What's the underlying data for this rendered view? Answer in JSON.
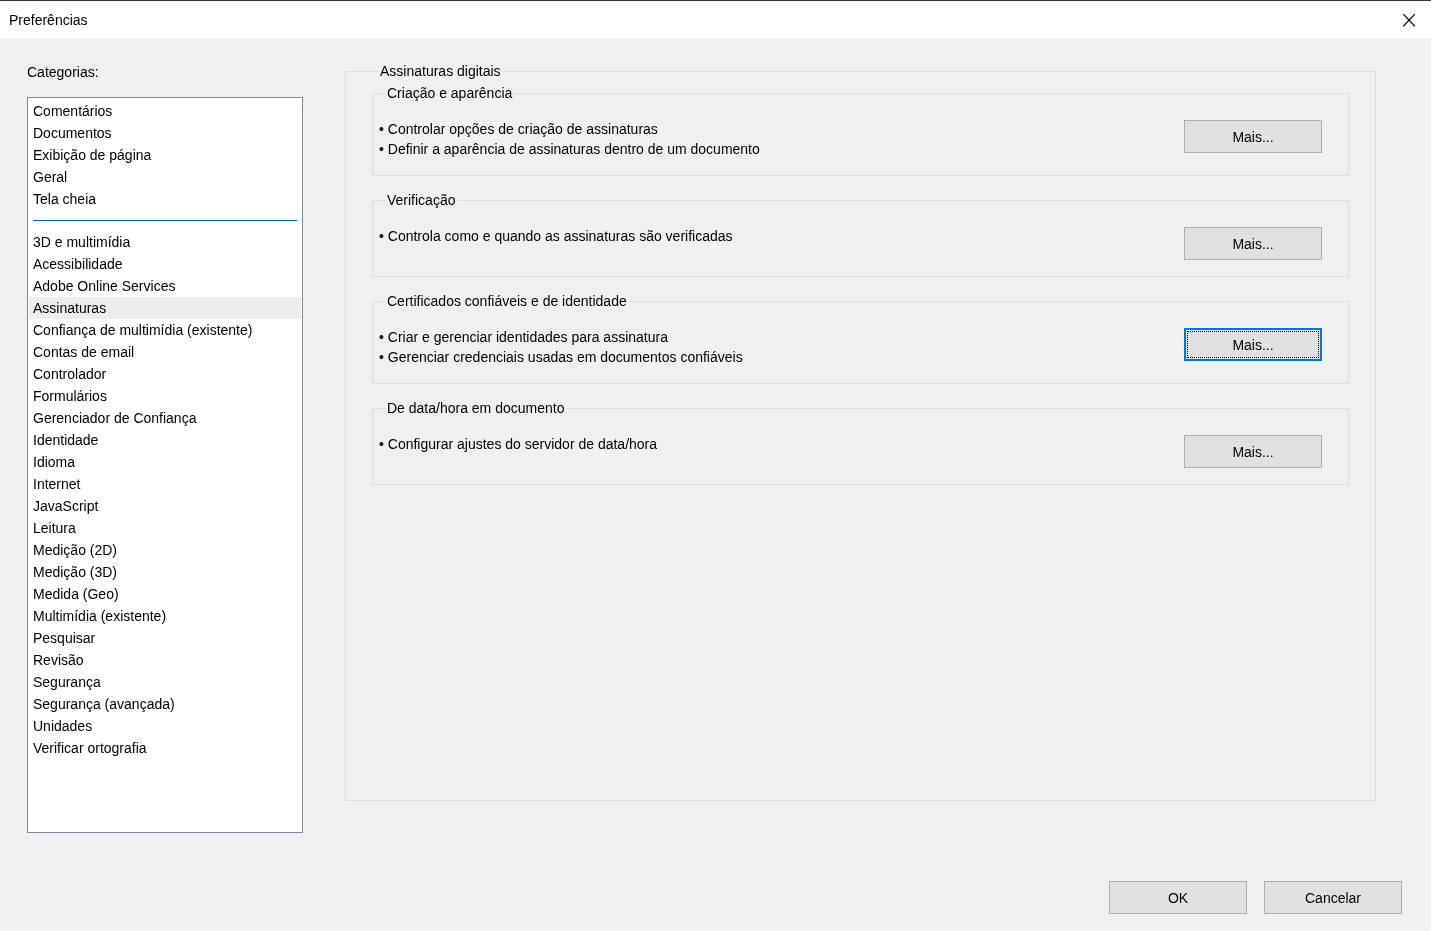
{
  "window": {
    "title": "Preferências",
    "close": "×"
  },
  "categories": {
    "label": "Categorias:",
    "groups": [
      [
        {
          "label": "Comentários",
          "selected": false
        },
        {
          "label": "Documentos",
          "selected": false
        },
        {
          "label": "Exibição de página",
          "selected": false
        },
        {
          "label": "Geral",
          "selected": false
        },
        {
          "label": "Tela cheia",
          "selected": false
        }
      ],
      [
        {
          "label": "3D e multimídia",
          "selected": false
        },
        {
          "label": "Acessibilidade",
          "selected": false
        },
        {
          "label": "Adobe Online Services",
          "selected": false
        },
        {
          "label": "Assinaturas",
          "selected": true
        },
        {
          "label": "Confiança de multimídia (existente)",
          "selected": false
        },
        {
          "label": "Contas de email",
          "selected": false
        },
        {
          "label": "Controlador",
          "selected": false
        },
        {
          "label": "Formulários",
          "selected": false
        },
        {
          "label": "Gerenciador de Confiança",
          "selected": false
        },
        {
          "label": "Identidade",
          "selected": false
        },
        {
          "label": "Idioma",
          "selected": false
        },
        {
          "label": "Internet",
          "selected": false
        },
        {
          "label": "JavaScript",
          "selected": false
        },
        {
          "label": "Leitura",
          "selected": false
        },
        {
          "label": "Medição (2D)",
          "selected": false
        },
        {
          "label": "Medição (3D)",
          "selected": false
        },
        {
          "label": "Medida (Geo)",
          "selected": false
        },
        {
          "label": "Multimídia (existente)",
          "selected": false
        },
        {
          "label": "Pesquisar",
          "selected": false
        },
        {
          "label": "Revisão",
          "selected": false
        },
        {
          "label": "Segurança",
          "selected": false
        },
        {
          "label": "Segurança (avançada)",
          "selected": false
        },
        {
          "label": "Unidades",
          "selected": false
        },
        {
          "label": "Verificar ortografia",
          "selected": false
        }
      ]
    ]
  },
  "panel": {
    "title": "Assinaturas digitais",
    "sections": [
      {
        "title": "Criação e aparência",
        "bullets": [
          "• Controlar opções de criação de assinaturas",
          "• Definir a aparência de assinaturas dentro de um documento"
        ],
        "button": "Mais...",
        "focused": false
      },
      {
        "title": "Verificação",
        "bullets": [
          "• Controla como e quando as assinaturas são verificadas"
        ],
        "button": "Mais...",
        "focused": false
      },
      {
        "title": "Certificados confiáveis e de identidade",
        "bullets": [
          "• Criar e gerenciar identidades para assinatura",
          "• Gerenciar credenciais usadas em documentos confiáveis"
        ],
        "button": "Mais...",
        "focused": true
      },
      {
        "title": "De data/hora em documento",
        "bullets": [
          "• Configurar ajustes do servidor de data/hora"
        ],
        "button": "Mais...",
        "focused": false
      }
    ]
  },
  "buttons": [
    "OK",
    "Cancelar"
  ]
}
